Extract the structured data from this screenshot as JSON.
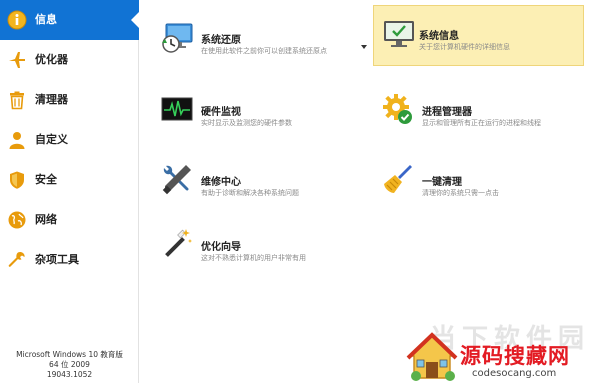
{
  "sidebar": {
    "items": [
      {
        "label": "信息",
        "icon": "info-icon",
        "active": true
      },
      {
        "label": "优化器",
        "icon": "airplane-icon",
        "active": false
      },
      {
        "label": "清理器",
        "icon": "trash-icon",
        "active": false
      },
      {
        "label": "自定义",
        "icon": "user-icon",
        "active": false
      },
      {
        "label": "安全",
        "icon": "shield-icon",
        "active": false
      },
      {
        "label": "网络",
        "icon": "globe-icon",
        "active": false
      },
      {
        "label": "杂项工具",
        "icon": "wrench-icon",
        "active": false
      }
    ],
    "version": {
      "line1": "Microsoft Windows 10 教育版",
      "line2": "64 位 2009",
      "line3": "19043.1052"
    }
  },
  "tiles": [
    {
      "title": "系统还原",
      "desc": "在使用此软件之前你可以创建系统还原点",
      "icon": "system-restore-icon"
    },
    {
      "title": "系统信息",
      "desc": "关于您计算机硬件的详细信息",
      "icon": "monitor-check-icon"
    },
    {
      "title": "硬件监视",
      "desc": "实时显示及监测您的硬件参数",
      "icon": "pulse-monitor-icon"
    },
    {
      "title": "进程管理器",
      "desc": "显示和管理所有正在运行的进程和线程",
      "icon": "gear-check-icon"
    },
    {
      "title": "维修中心",
      "desc": "有助于诊断和解决各种系统问题",
      "icon": "tools-icon"
    },
    {
      "title": "一键清理",
      "desc": "清理你的系统只需一点击",
      "icon": "broom-icon"
    },
    {
      "title": "优化向导",
      "desc": "这对不熟悉计算机的用户非常有用",
      "icon": "magic-wand-icon"
    }
  ],
  "watermark": {
    "bg_text": "当下软件园",
    "main_text": "源码搜藏网",
    "url": "codesocang.com"
  },
  "colors": {
    "active": "#1173d4",
    "highlight": "#fcefb4",
    "watermark_red": "#e31b23"
  }
}
